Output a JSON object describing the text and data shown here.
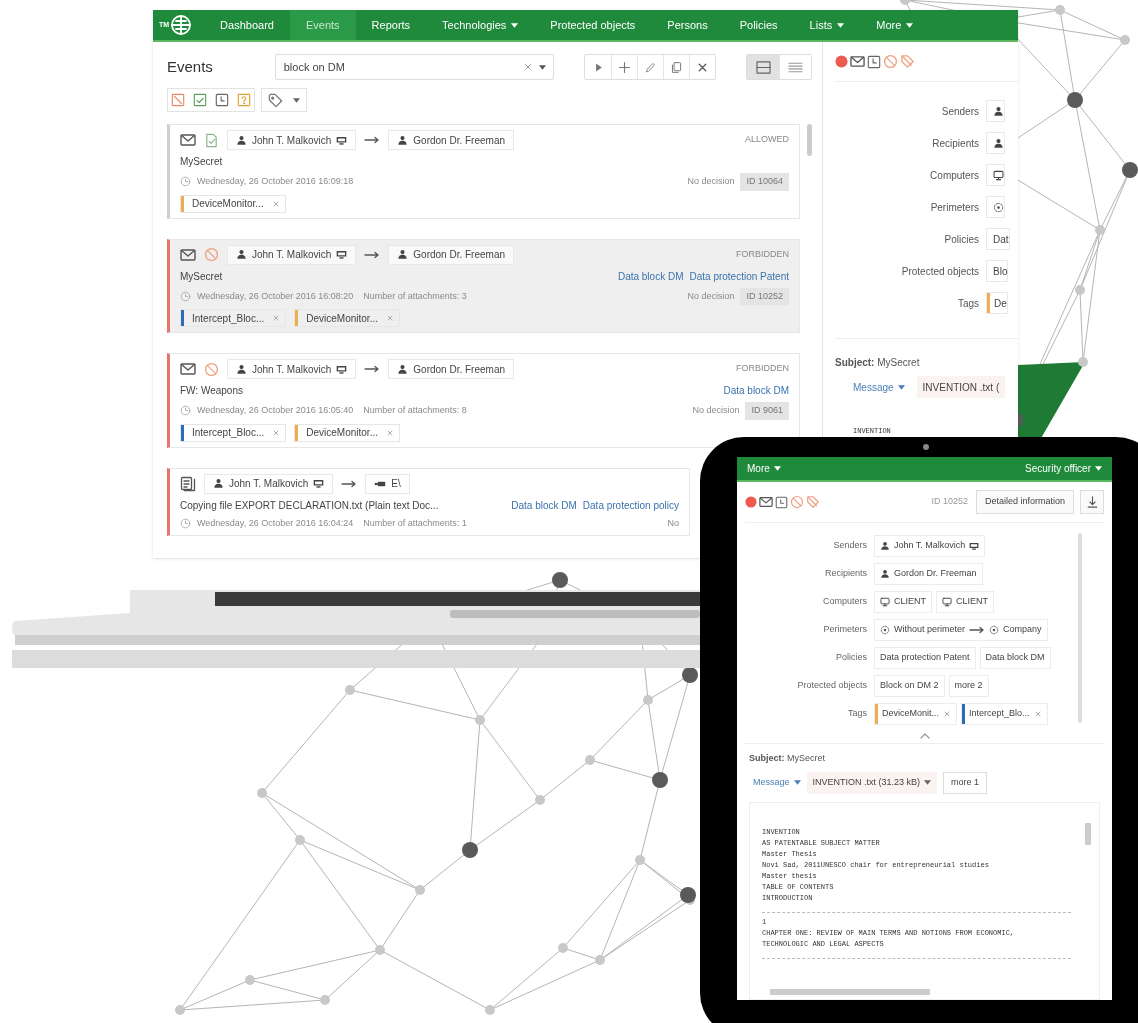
{
  "laptop": {
    "logo_text": "TM",
    "nav": [
      {
        "label": "Dashboard",
        "selected": false,
        "dropdown": false
      },
      {
        "label": "Events",
        "selected": true,
        "dropdown": false
      },
      {
        "label": "Reports",
        "selected": false,
        "dropdown": false
      },
      {
        "label": "Technologies",
        "selected": false,
        "dropdown": true
      },
      {
        "label": "Protected objects",
        "selected": false,
        "dropdown": false
      },
      {
        "label": "Persons",
        "selected": false,
        "dropdown": false
      },
      {
        "label": "Policies",
        "selected": false,
        "dropdown": false
      },
      {
        "label": "Lists",
        "selected": false,
        "dropdown": true
      },
      {
        "label": "More",
        "selected": false,
        "dropdown": true
      }
    ],
    "events_panel": {
      "title": "Events",
      "search": {
        "value": "block on DM"
      },
      "view_modes": [
        {
          "kind": "cards",
          "selected": true
        },
        {
          "kind": "list",
          "selected": false
        }
      ],
      "events": [
        {
          "icons": [
            {
              "kind": "email"
            },
            {
              "kind": "allowed"
            }
          ],
          "sender": {
            "kind": "person",
            "text": "John T. Malkovich",
            "agent": true
          },
          "recipient": {
            "kind": "person",
            "text": "Gordon Dr. Freeman"
          },
          "verdict": "ALLOWED",
          "subject": "MySecret",
          "time": "Wednesday, 26 October 2016 16:09:18",
          "decision": "No decision",
          "id": "ID 10064",
          "tags": [
            {
              "kind": "tag",
              "text": "DeviceMonitor...",
              "color": "#f0ad4e",
              "removable": true
            }
          ],
          "selected": false,
          "violation": false
        },
        {
          "icons": [
            {
              "kind": "email"
            },
            {
              "kind": "forbidden"
            }
          ],
          "sender": {
            "kind": "person",
            "text": "John T. Malkovich",
            "agent": true
          },
          "recipient": {
            "kind": "person",
            "text": "Gordon Dr. Freeman"
          },
          "verdict": "FORBIDDEN",
          "subject": "MySecret",
          "policies": [
            "Data block DM",
            "Data protection Patent"
          ],
          "time": "Wednesday, 26 October 2016 16:08:20",
          "attachments": "Number of attachments: 3",
          "decision": "No decision",
          "id": "ID 10252",
          "tags": [
            {
              "kind": "tag",
              "text": "Intercept_Bloc...",
              "color": "#2a6ebb",
              "removable": true
            },
            {
              "kind": "tag",
              "text": "DeviceMonitor...",
              "color": "#f0ad4e",
              "removable": true
            }
          ],
          "selected": true,
          "violation": true
        },
        {
          "icons": [
            {
              "kind": "email"
            },
            {
              "kind": "forbidden"
            }
          ],
          "sender": {
            "kind": "person",
            "text": "John T. Malkovich",
            "agent": true
          },
          "recipient": {
            "kind": "person",
            "text": "Gordon Dr. Freeman"
          },
          "verdict": "FORBIDDEN",
          "subject": "FW: Weapons",
          "policies": [
            "Data block DM"
          ],
          "time": "Wednesday, 26 October 2016 16:05:40",
          "attachments": "Number of attachments: 8",
          "decision": "No decision",
          "id": "ID 9061",
          "tags": [
            {
              "kind": "tag",
              "text": "Intercept_Bloc...",
              "color": "#2a6ebb",
              "removable": true
            },
            {
              "kind": "tag",
              "text": "DeviceMonitor...",
              "color": "#f0ad4e",
              "removable": true
            }
          ],
          "selected": false,
          "violation": true
        },
        {
          "icons": [
            {
              "kind": "copy"
            }
          ],
          "sender": {
            "kind": "person",
            "text": "John T. Malkovich",
            "agent": true
          },
          "recipient": {
            "kind": "device",
            "text": "E\\"
          },
          "subject": "Copying file EXPORT DECLARATION.txt (Plain text Doc...",
          "policies": [
            "Data block DM",
            "Data protection policy"
          ],
          "time": "Wednesday, 26 October 2016 16:04:24",
          "attachments": "Number of attachments: 1",
          "decision": "No",
          "selected": false,
          "violation": true
        }
      ]
    },
    "details": {
      "fields": [
        {
          "label": "Senders",
          "values": [
            {
              "kind": "person"
            }
          ]
        },
        {
          "label": "Recipients",
          "values": [
            {
              "kind": "person"
            }
          ]
        },
        {
          "label": "Computers",
          "values": [
            {
              "kind": "computer"
            }
          ]
        },
        {
          "label": "Perimeters",
          "values": [
            {
              "kind": "perimeter"
            }
          ]
        },
        {
          "label": "Policies",
          "values": [
            {
              "kind": "text",
              "text": "Dat"
            }
          ]
        },
        {
          "label": "Protected objects",
          "values": [
            {
              "kind": "text",
              "text": "Blo"
            }
          ]
        },
        {
          "label": "Tags",
          "values": [
            {
              "kind": "tag",
              "text": "De",
              "color": "#f0ad4e"
            }
          ]
        }
      ],
      "subject": "**Subject:** MySecret",
      "message_menu": "Message",
      "attachment": "INVENTION .txt (",
      "preview": [
        "INVENTION"
      ]
    }
  },
  "tablet": {
    "header_left": "More",
    "header_right": "Security officer",
    "id": "ID 10252",
    "details_button": "Detailed information",
    "fields": [
      {
        "label": "Senders",
        "values": [
          {
            "kind": "person",
            "text": "John T. Malkovich",
            "agent": true
          }
        ]
      },
      {
        "label": "Recipients",
        "values": [
          {
            "kind": "person",
            "text": "Gordon Dr. Freeman"
          }
        ]
      },
      {
        "label": "Computers",
        "values": [
          {
            "kind": "computer",
            "text": "CLIENT"
          },
          {
            "kind": "computer",
            "text": "CLIENT"
          }
        ]
      },
      {
        "label": "Perimeters",
        "values": [
          {
            "kind": "route",
            "from": "Without perimeter",
            "to": "Company"
          }
        ]
      },
      {
        "label": "Policies",
        "values": [
          {
            "kind": "text",
            "text": "Data protection Patent"
          },
          {
            "kind": "text",
            "text": "Data block DM"
          }
        ]
      },
      {
        "label": "Protected objects",
        "values": [
          {
            "kind": "text",
            "text": "Block on DM 2"
          },
          {
            "kind": "text",
            "text": "more 2"
          }
        ]
      },
      {
        "label": "Tags",
        "values": [
          {
            "kind": "tag",
            "text": "DeviceMonit...",
            "color": "#f0ad4e",
            "removable": true
          },
          {
            "kind": "tag",
            "text": "Intercept_Blo...",
            "color": "#2a6ebb",
            "removable": true
          }
        ]
      }
    ],
    "subject": "**Subject:** MySecret",
    "message_menu": "Message",
    "attachment": "INVENTION .txt (31.23 kB)",
    "more": "more 1",
    "preview_sections": [
      [
        "INVENTION",
        "AS PATENTABLE SUBJECT MATTER",
        "Master Thesis",
        "Novi Sad, 2011UNESCO chair for entrepreneurial studies",
        "Master thesis",
        "TABLE OF CONTENTS",
        "INTRODUCTION"
      ],
      [
        "1",
        "CHAPTER ONE: REVIEW OF MAIN TERMS AND NOTIONS FROM ECONOMIC,",
        "TECHNOLOGIC AND LEGAL ASPECTS"
      ]
    ]
  }
}
